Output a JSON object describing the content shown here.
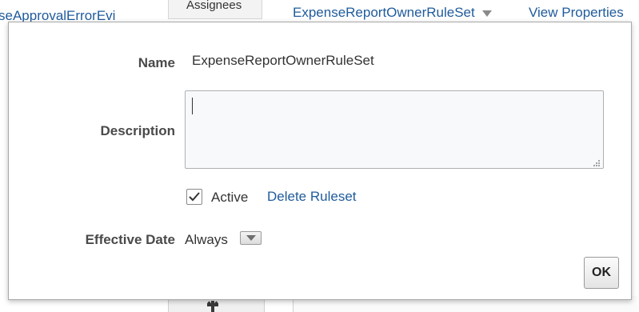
{
  "background": {
    "left_link": "seApprovalErrorEvi",
    "tab_label": "Assignees",
    "ruleset_selector": "ExpenseReportOwnerRuleSet",
    "view_properties_link": "View Properties",
    "link_color": "#1f5b9c"
  },
  "dialog": {
    "name_label": "Name",
    "name_value": "ExpenseReportOwnerRuleSet",
    "description_label": "Description",
    "description_value": "",
    "active_label": "Active",
    "active_checked": true,
    "delete_link": "Delete Ruleset",
    "effective_date_label": "Effective Date",
    "effective_date_value": "Always",
    "ok_label": "OK"
  },
  "icons": {
    "ruleset_dropdown": "chevron-down-icon",
    "effective_date_dropdown": "chevron-down-icon",
    "active_checkbox": "checkmark-icon",
    "resize_grip": "resize-grip-icon",
    "toolbar": "gear-icon"
  }
}
